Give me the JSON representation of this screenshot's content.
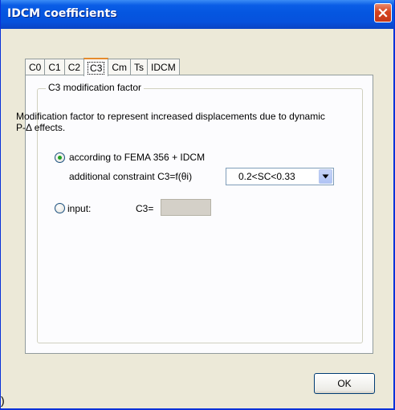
{
  "window": {
    "title": "IDCM coefficients"
  },
  "tabs": [
    {
      "label": "C0",
      "active": false
    },
    {
      "label": "C1",
      "active": false
    },
    {
      "label": "C2",
      "active": false
    },
    {
      "label": "C3",
      "active": true
    },
    {
      "label": "Cm",
      "active": false
    },
    {
      "label": "Ts",
      "active": false
    },
    {
      "label": "IDCM",
      "active": false
    }
  ],
  "group": {
    "title": "C3 modification factor",
    "description": "Modification factor to represent increased displacements due to dynamic P-Δ effects."
  },
  "options": {
    "fema": {
      "label": "according to FEMA 356 + IDCM",
      "selected": true
    },
    "constraint_label": "additional constraint C3=f(θi)",
    "constraint_value": "0.2<SC<0.33",
    "input": {
      "label": "input:",
      "selected": false,
      "field_label": "C3=",
      "field_value": ""
    }
  },
  "buttons": {
    "ok": "OK"
  },
  "colors": {
    "titlebar": "#0556e0",
    "dialog_bg": "#ece9d8",
    "active_tab_accent": "#e68b2c",
    "radio_dot": "#21a121"
  }
}
